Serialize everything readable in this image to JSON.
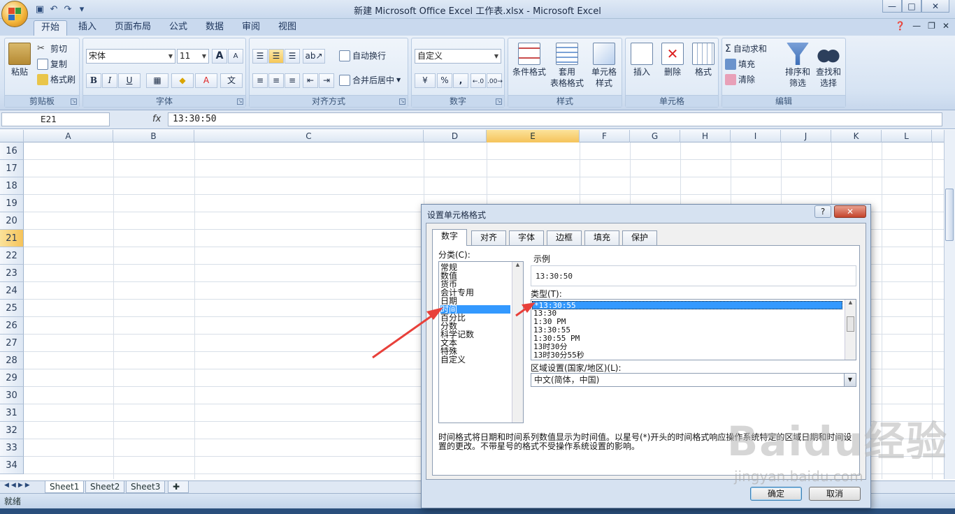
{
  "window": {
    "title": "新建 Microsoft Office Excel 工作表.xlsx - Microsoft Excel",
    "controls": [
      "—",
      "□",
      "✕"
    ]
  },
  "quick_access": [
    "save-icon",
    "undo-icon",
    "redo-icon",
    "customize-icon"
  ],
  "ribbon_tabs": [
    "开始",
    "插入",
    "页面布局",
    "公式",
    "数据",
    "审阅",
    "视图"
  ],
  "active_tab": "开始",
  "ribbon": {
    "clipboard": {
      "label": "剪贴板",
      "paste": "粘贴",
      "cut": "剪切",
      "copy": "复制",
      "format_painter": "格式刷"
    },
    "font": {
      "label": "字体",
      "font_name": "宋体",
      "font_size": "11",
      "grow": "A",
      "shrink": "A",
      "bold": "B",
      "italic": "I",
      "underline": "U"
    },
    "alignment": {
      "label": "对齐方式",
      "wrap": "自动换行",
      "merge": "合并后居中"
    },
    "number": {
      "label": "数字",
      "format": "自定义",
      "percent": "%",
      "comma": ","
    },
    "styles": {
      "label": "样式",
      "conditional": "条件格式",
      "table_line1": "套用",
      "table_line2": "表格格式",
      "cell_line1": "单元格",
      "cell_line2": "样式"
    },
    "cells": {
      "label": "单元格",
      "insert": "插入",
      "delete": "删除",
      "format": "格式"
    },
    "editing": {
      "label": "编辑",
      "autosum": "自动求和",
      "fill": "填充",
      "clear": "清除",
      "sort_line1": "排序和",
      "sort_line2": "筛选",
      "find_line1": "查找和",
      "find_line2": "选择"
    }
  },
  "formula_bar": {
    "name_box": "E21",
    "fx": "fx",
    "value": "13:30:50"
  },
  "columns": [
    "A",
    "B",
    "C",
    "D",
    "E",
    "F",
    "G",
    "H",
    "I",
    "J",
    "K",
    "L"
  ],
  "selected_column": "E",
  "rows": [
    "16",
    "17",
    "18",
    "19",
    "20",
    "21",
    "22",
    "23",
    "24",
    "25",
    "26",
    "27",
    "28",
    "29",
    "30",
    "31",
    "32",
    "33",
    "34"
  ],
  "selected_row": "21",
  "sheets": [
    "Sheet1",
    "Sheet2",
    "Sheet3"
  ],
  "status": "就绪",
  "dialog": {
    "title": "设置单元格格式",
    "help": "?",
    "close": "✕",
    "tabs": [
      "数字",
      "对齐",
      "字体",
      "边框",
      "填充",
      "保护"
    ],
    "active_tab": "数字",
    "category_label": "分类(C):",
    "categories": [
      "常规",
      "数值",
      "货币",
      "会计专用",
      "日期",
      "时间",
      "百分比",
      "分数",
      "科学记数",
      "文本",
      "特殊",
      "自定义"
    ],
    "selected_category": "时间",
    "sample_label": "示例",
    "sample_value": "13:30:50",
    "type_label": "类型(T):",
    "types": [
      "*13:30:55",
      "13:30",
      "1:30 PM",
      "13:30:55",
      "1:30:55 PM",
      "13时30分",
      "13时30分55秒"
    ],
    "selected_type": "*13:30:55",
    "locale_label": "区域设置(国家/地区)(L):",
    "locale_value": "中文(简体，中国)",
    "description": "时间格式将日期和时间系列数值显示为时间值。以星号(*)开头的时间格式响应操作系统特定的区域日期和时间设置的更改。不带星号的格式不受操作系统设置的影响。",
    "ok": "确定",
    "cancel": "取消"
  },
  "watermark": {
    "main": "Baidu经验",
    "sub": "jingyan.baidu.com"
  },
  "colors": {
    "accent": "#f5c35a",
    "selection": "#3399ff",
    "ribbon": "#dde8f5",
    "arrow": "#e8403a"
  }
}
